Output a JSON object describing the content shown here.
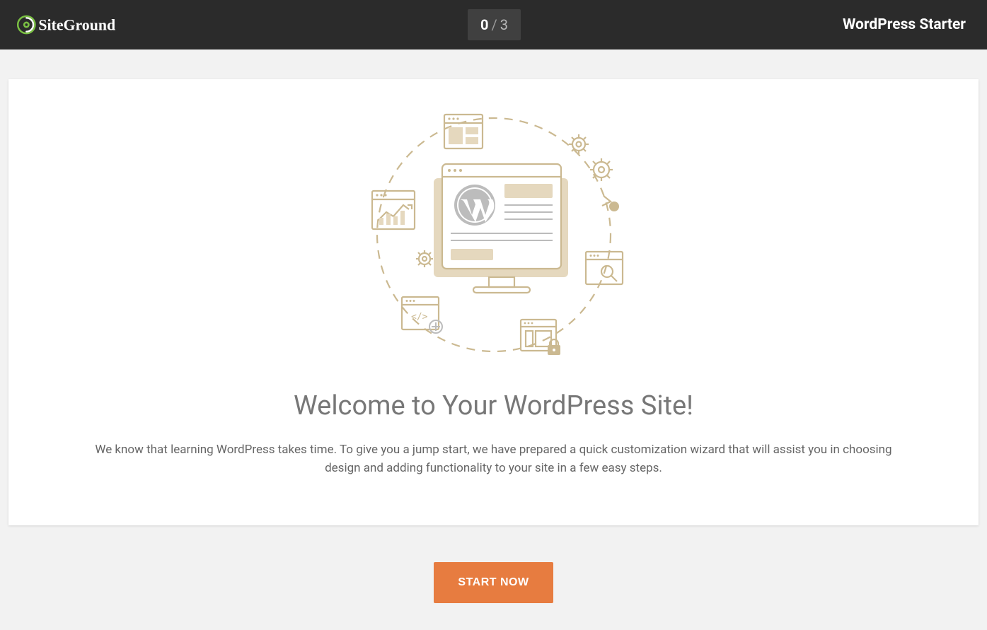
{
  "header": {
    "brand": "SiteGround",
    "product": "WordPress Starter",
    "step_current": "0",
    "step_separator": "/",
    "step_total": "3"
  },
  "main": {
    "title": "Welcome to Your WordPress Site!",
    "description": "We know that learning WordPress takes time. To give you a jump start, we have prepared a quick customization wizard that will assist you in choosing design and adding functionality to your site in a few easy steps."
  },
  "actions": {
    "start_label": "START NOW"
  },
  "colors": {
    "header_bg": "#2b2b2b",
    "accent": "#e77c40",
    "logo_accent": "#7bc143",
    "illustration_stroke": "#cbb991",
    "illustration_fill": "#e5d8be"
  }
}
